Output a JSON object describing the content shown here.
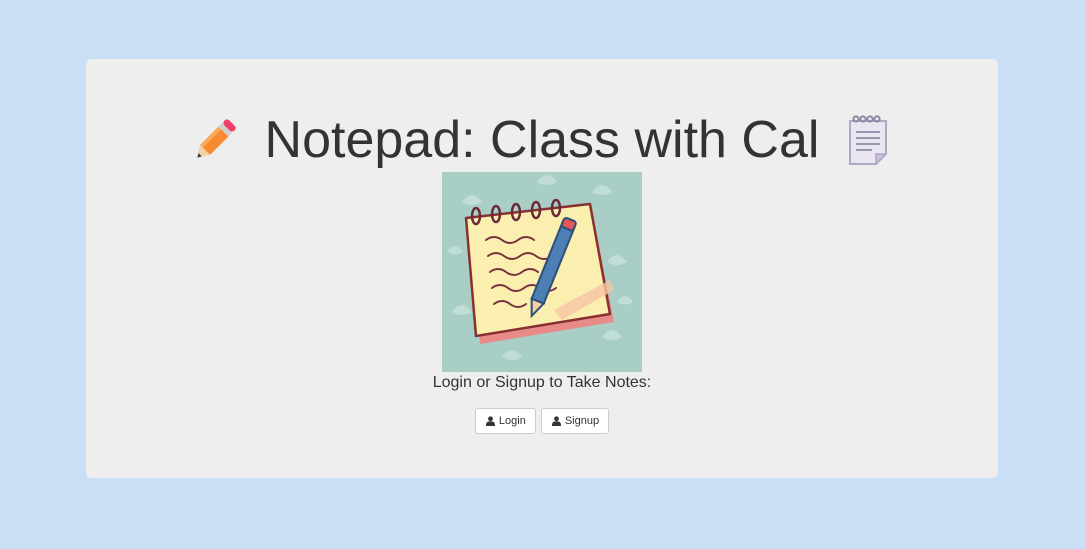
{
  "page": {
    "title": "Notepad: Class with Cal",
    "prompt": "Login or Signup to Take Notes:"
  },
  "icons": {
    "title_left": "pencil-icon",
    "title_right": "spiral-notepad-icon",
    "button_icon": "user-icon"
  },
  "buttons": {
    "login_label": "Login",
    "signup_label": "Signup"
  },
  "colors": {
    "background": "#c8dff5",
    "panel": "#eeeeee",
    "text": "#333333"
  }
}
